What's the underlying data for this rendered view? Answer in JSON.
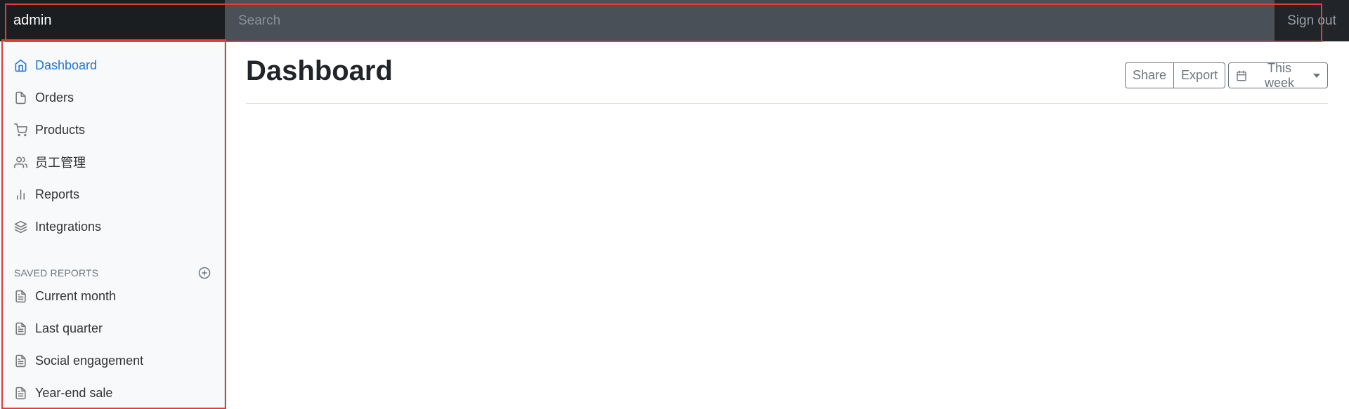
{
  "navbar": {
    "brand": "admin",
    "search_placeholder": "Search",
    "signout_label": "Sign out"
  },
  "sidebar": {
    "items": [
      {
        "label": "Dashboard",
        "icon": "home-icon",
        "active": true
      },
      {
        "label": "Orders",
        "icon": "file-icon"
      },
      {
        "label": "Products",
        "icon": "shopping-cart-icon"
      },
      {
        "label": "员工管理",
        "icon": "users-icon"
      },
      {
        "label": "Reports",
        "icon": "bar-chart-icon"
      },
      {
        "label": "Integrations",
        "icon": "layers-icon"
      }
    ],
    "saved_reports_heading": "SAVED REPORTS",
    "saved_reports": [
      {
        "label": "Current month",
        "icon": "file-text-icon"
      },
      {
        "label": "Last quarter",
        "icon": "file-text-icon"
      },
      {
        "label": "Social engagement",
        "icon": "file-text-icon"
      },
      {
        "label": "Year-end sale",
        "icon": "file-text-icon"
      }
    ]
  },
  "main": {
    "title": "Dashboard",
    "toolbar": {
      "share_label": "Share",
      "export_label": "Export",
      "period_label": "This week"
    }
  },
  "colors": {
    "navbar_bg": "#212529",
    "search_bg": "#495057",
    "sidebar_bg": "#f8f9fa",
    "active_link": "#1f75d7",
    "highlight_border": "#e53b3b"
  }
}
